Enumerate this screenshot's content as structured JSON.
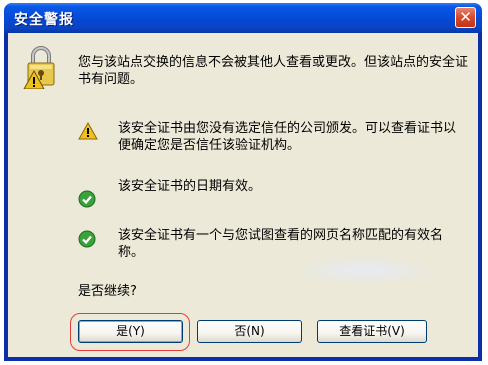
{
  "window": {
    "title": "安全警报",
    "close_glyph": "✕"
  },
  "message": {
    "main": "您与该站点交换的信息不会被其他人查看或更改。但该站点的安全证书有问题。"
  },
  "items": [
    {
      "icon": "warning-icon",
      "text": "该安全证书由您没有选定信任的公司颁发。可以查看证书以便确定您是否信任该验证机构。"
    },
    {
      "icon": "check-icon",
      "text": "该安全证书的日期有效。"
    },
    {
      "icon": "check-icon",
      "text": "该安全证书有一个与您试图查看的网页名称匹配的有效名称。"
    }
  ],
  "prompt": "是否继续?",
  "buttons": {
    "yes": "是(Y)",
    "no": "否(N)",
    "view_cert": "查看证书(V)"
  },
  "colors": {
    "titlebar": "#0648d4",
    "client_bg": "#ece9d8",
    "close_button": "#d8482a",
    "warning": "#f0c020",
    "check": "#3aa23a",
    "highlight": "#e33d3d"
  }
}
